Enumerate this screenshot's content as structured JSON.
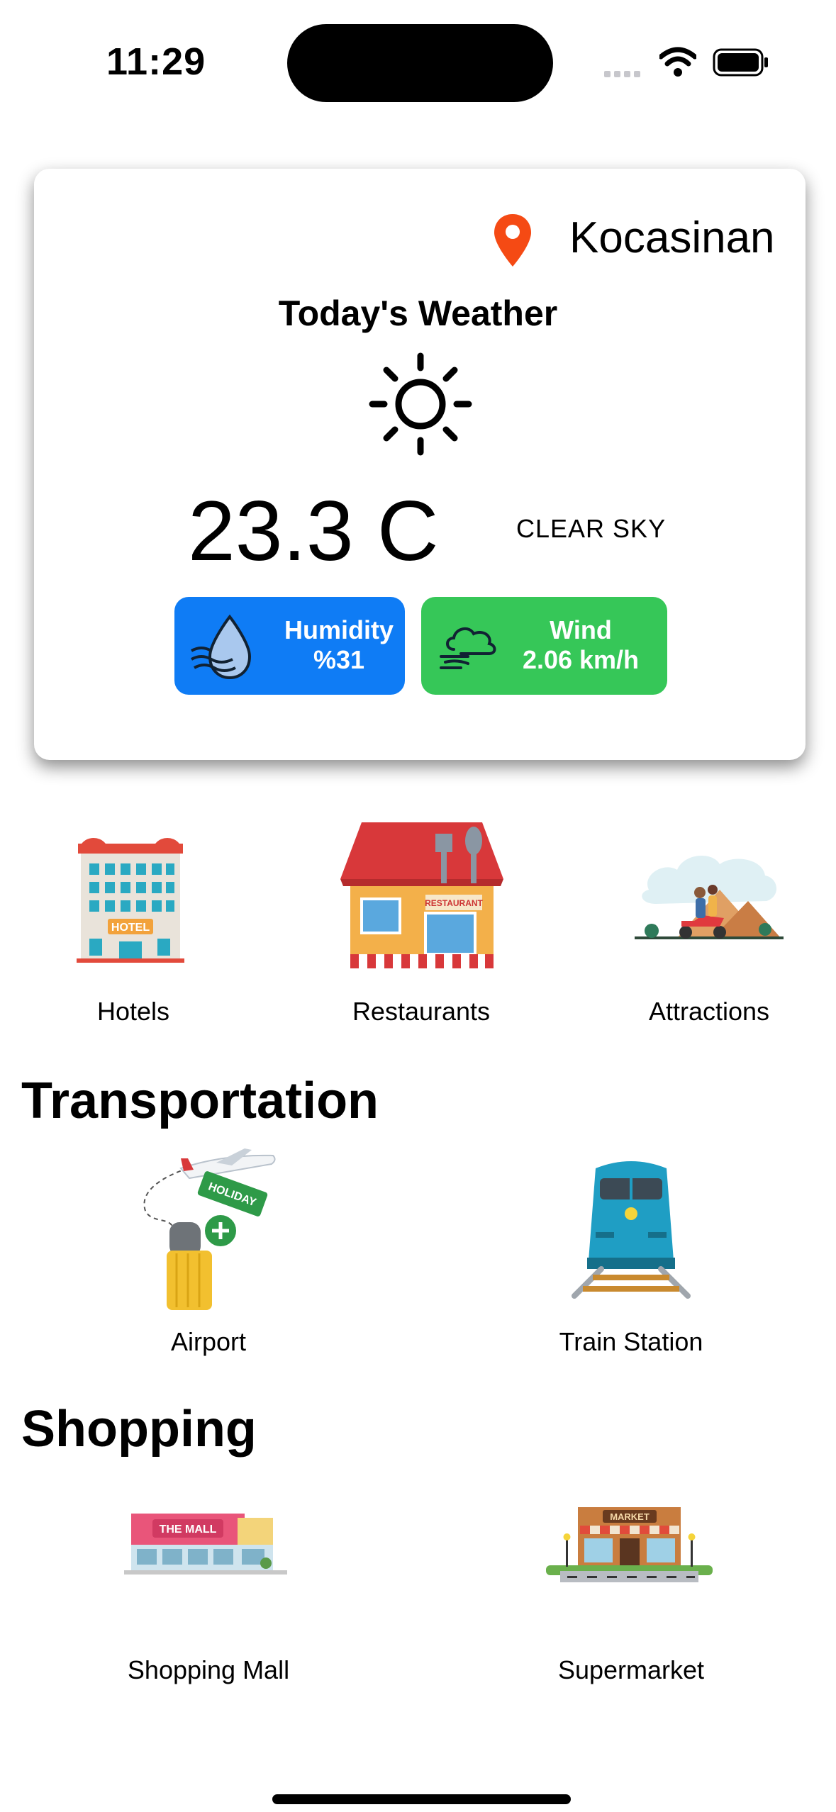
{
  "status_bar": {
    "time": "11:29"
  },
  "weather": {
    "location": "Kocasinan",
    "title": "Today's Weather",
    "condition_icon": "sun-icon",
    "temperature": "23.3 C",
    "description": "CLEAR SKY",
    "humidity": {
      "label": "Humidity",
      "value": "%31",
      "icon": "humidity-drop-icon",
      "color": "#0f7cf5"
    },
    "wind": {
      "label": "Wind",
      "value": "2.06 km/h",
      "icon": "wind-cloud-icon",
      "color": "#36c758"
    }
  },
  "categories": [
    {
      "label": "Hotels",
      "icon": "hotel-icon"
    },
    {
      "label": "Restaurants",
      "icon": "restaurant-icon"
    },
    {
      "label": "Attractions",
      "icon": "attractions-icon"
    }
  ],
  "transportation": {
    "title": "Transportation",
    "items": [
      {
        "label": "Airport",
        "icon": "airport-icon",
        "badge": "HOLIDAY"
      },
      {
        "label": "Train Station",
        "icon": "train-icon"
      }
    ]
  },
  "shopping": {
    "title": "Shopping",
    "items": [
      {
        "label": "Shopping Mall",
        "icon": "mall-icon",
        "sign": "THE MALL"
      },
      {
        "label": "Supermarket",
        "icon": "supermarket-icon",
        "sign": "MARKET"
      }
    ]
  }
}
